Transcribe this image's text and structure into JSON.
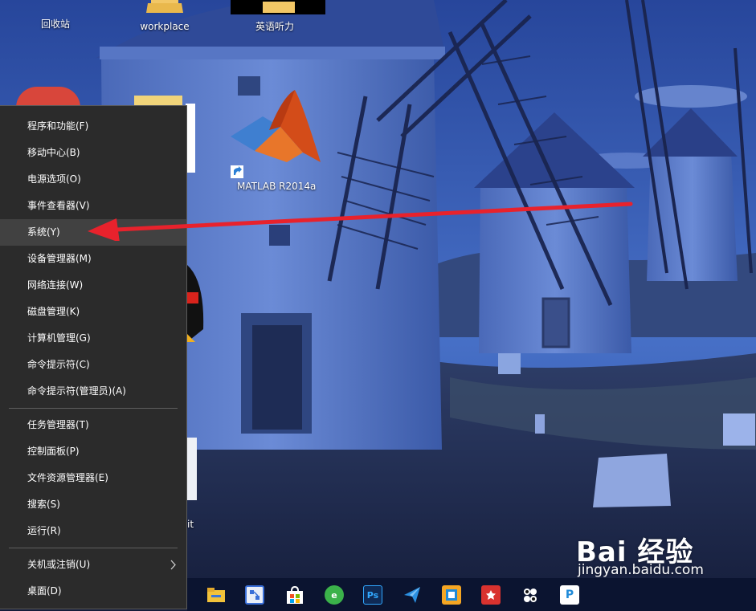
{
  "desktop": {
    "icons": [
      {
        "label": "回收站",
        "icon": "recycle-bin-icon"
      },
      {
        "label": "workplace",
        "icon": "folder-icon"
      },
      {
        "label": "英语听力",
        "icon": "folder-icon"
      },
      {
        "label": "MATLAB R2014a",
        "icon": "matlab-icon"
      }
    ],
    "partial_label": "it"
  },
  "winx_menu": {
    "groups": [
      [
        {
          "label": "程序和功能(F)"
        },
        {
          "label": "移动中心(B)"
        },
        {
          "label": "电源选项(O)"
        },
        {
          "label": "事件查看器(V)"
        },
        {
          "label": "系统(Y)",
          "highlighted": true
        },
        {
          "label": "设备管理器(M)"
        },
        {
          "label": "网络连接(W)"
        },
        {
          "label": "磁盘管理(K)"
        },
        {
          "label": "计算机管理(G)"
        },
        {
          "label": "命令提示符(C)"
        },
        {
          "label": "命令提示符(管理员)(A)"
        }
      ],
      [
        {
          "label": "任务管理器(T)"
        },
        {
          "label": "控制面板(P)"
        },
        {
          "label": "文件资源管理器(E)"
        },
        {
          "label": "搜索(S)"
        },
        {
          "label": "运行(R)"
        }
      ],
      [
        {
          "label": "关机或注销(U)",
          "has_submenu": true
        },
        {
          "label": "桌面(D)"
        }
      ]
    ]
  },
  "taskbar": {
    "icons": [
      {
        "name": "file-explorer-icon",
        "color": "#f2c23a",
        "glyph": ""
      },
      {
        "name": "network-app-icon",
        "color": "#3a6fd8",
        "glyph": ""
      },
      {
        "name": "store-icon",
        "color": "#ffffff",
        "glyph": ""
      },
      {
        "name": "360-browser-icon",
        "color": "#3bb24a",
        "glyph": "e"
      },
      {
        "name": "photoshop-icon",
        "color": "#0f2a55",
        "glyph": "Ps"
      },
      {
        "name": "feiyu-icon",
        "color": "#2b8fe0",
        "glyph": ""
      },
      {
        "name": "windows-app-icon",
        "color": "#f5a623",
        "glyph": ""
      },
      {
        "name": "wps-icon",
        "color": "#d9322f",
        "glyph": ""
      },
      {
        "name": "qq-icon",
        "color": "#1a1a1a",
        "glyph": ""
      },
      {
        "name": "pp-assistant-icon",
        "color": "#1f8ad8",
        "glyph": "P"
      }
    ]
  },
  "watermark": {
    "brand": "Bai 经验",
    "url": "jingyan.baidu.com"
  },
  "colors": {
    "menu_bg": "#2b2b2b",
    "menu_highlight": "#414141",
    "menu_text": "#ffffff",
    "annotation_arrow": "#e8222c"
  }
}
